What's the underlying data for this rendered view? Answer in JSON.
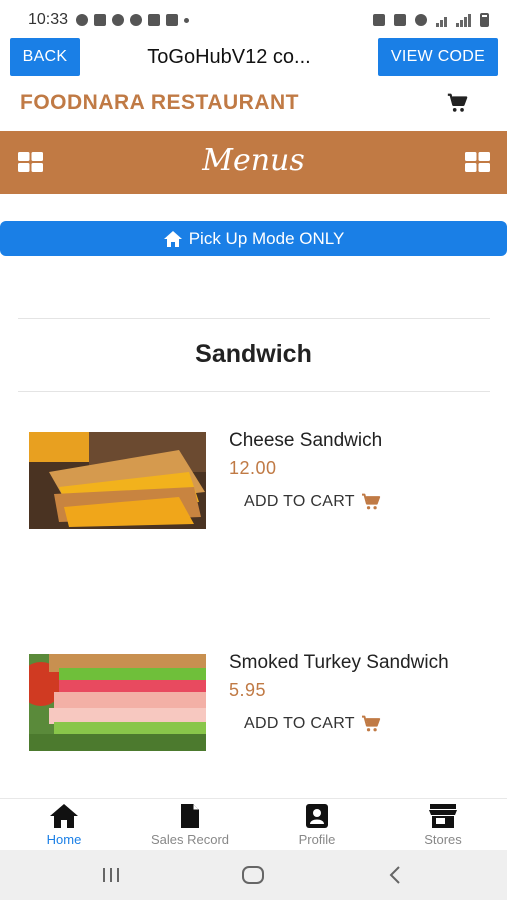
{
  "status_bar": {
    "time": "10:33"
  },
  "header": {
    "back_label": "BACK",
    "title": "ToGoHubV12 co...",
    "view_code_label": "VIEW CODE"
  },
  "brand": {
    "name": "FOODNARA RESTAURANT"
  },
  "menu_bar": {
    "title": "Menus"
  },
  "pickup": {
    "label": "Pick Up Mode ONLY"
  },
  "section": {
    "title": "Sandwich"
  },
  "items": [
    {
      "name": "Cheese Sandwich",
      "price": "12.00",
      "cta": "ADD TO CART"
    },
    {
      "name": "Smoked Turkey Sandwich",
      "price": "5.95",
      "cta": "ADD TO CART"
    }
  ],
  "tabs": [
    {
      "label": "Home",
      "icon": "home-icon",
      "active": true
    },
    {
      "label": "Sales Record",
      "icon": "file-icon",
      "active": false
    },
    {
      "label": "Profile",
      "icon": "profile-icon",
      "active": false
    },
    {
      "label": "Stores",
      "icon": "store-icon",
      "active": false
    }
  ],
  "colors": {
    "accent": "#1a7fe6",
    "brand": "#c17a44"
  }
}
